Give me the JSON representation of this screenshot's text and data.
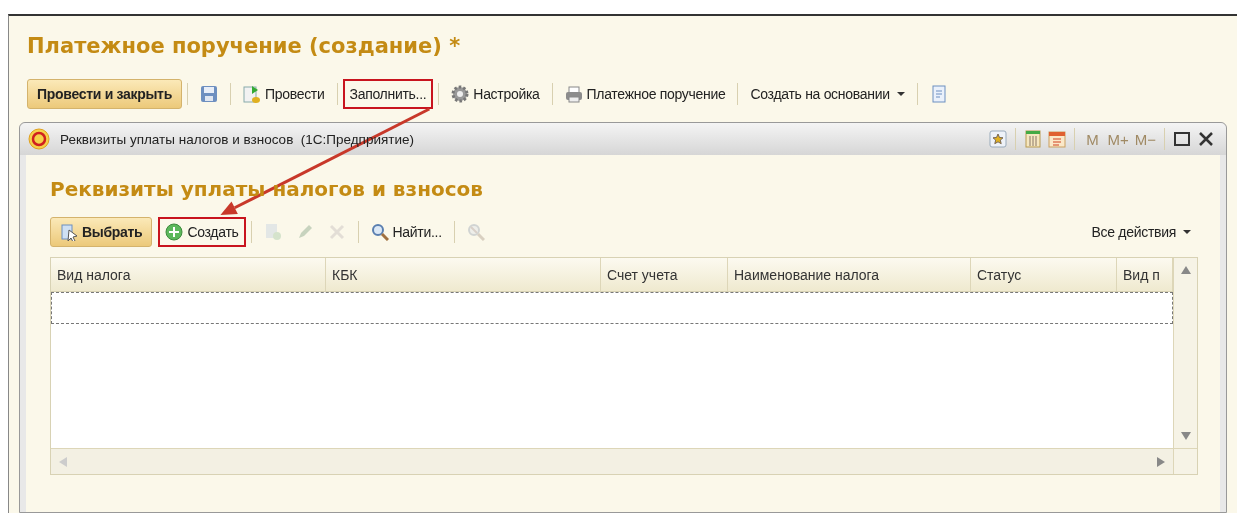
{
  "window": {
    "title": "Платежное поручение (создание) *"
  },
  "toolbar": [
    {
      "kind": "default",
      "label": "Провести и закрыть",
      "highlighted": false
    },
    {
      "kind": "icon",
      "highlighted": false
    },
    {
      "kind": "button",
      "label": "Провести",
      "highlighted": false
    },
    {
      "kind": "button",
      "label": "Заполнить...",
      "highlighted": true
    },
    {
      "kind": "button",
      "label": "Настройка",
      "highlighted": false
    },
    {
      "kind": "button",
      "label": "Платежное поручение",
      "highlighted": false
    },
    {
      "kind": "dropdown",
      "label": "Создать на основании",
      "highlighted": false
    },
    {
      "kind": "icon",
      "highlighted": false
    }
  ],
  "dialog": {
    "title": "Реквизиты уплаты налогов и взносов  (1С:Предприятие)",
    "title_buttons": [
      {
        "kind": "icon",
        "disabled": false
      },
      {
        "kind": "icon",
        "disabled": false
      },
      {
        "kind": "icon",
        "disabled": false
      },
      {
        "kind": "text",
        "label": "M",
        "disabled": true
      },
      {
        "kind": "text",
        "label": "M+",
        "disabled": true
      },
      {
        "kind": "text",
        "label": "M−",
        "disabled": true
      },
      {
        "kind": "icon",
        "disabled": false
      },
      {
        "kind": "icon",
        "disabled": false
      }
    ],
    "heading": "Реквизиты уплаты налогов и взносов",
    "toolbar": [
      {
        "kind": "default",
        "label": "Выбрать",
        "highlighted": false,
        "disabled": false
      },
      {
        "kind": "button",
        "label": "Создать",
        "highlighted": true,
        "disabled": false
      },
      {
        "kind": "icon",
        "highlighted": false,
        "disabled": true
      },
      {
        "kind": "icon",
        "highlighted": false,
        "disabled": true
      },
      {
        "kind": "icon",
        "highlighted": false,
        "disabled": true
      },
      {
        "kind": "button",
        "label": "Найти...",
        "highlighted": false,
        "disabled": false
      },
      {
        "kind": "icon",
        "highlighted": false,
        "disabled": true
      }
    ],
    "all_actions": "Все действия",
    "table": {
      "columns": [
        "Вид налога",
        "КБК",
        "Счет учета",
        "Наименование налога",
        "Статус",
        "Вид п"
      ]
    }
  }
}
